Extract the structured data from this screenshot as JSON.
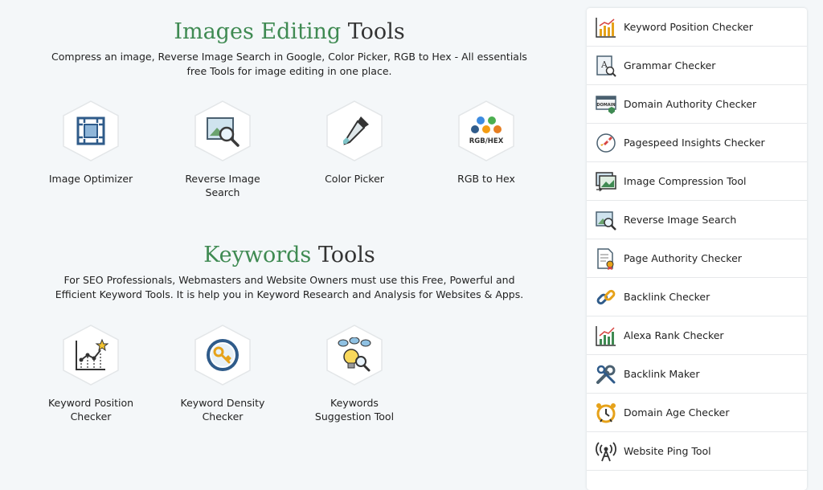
{
  "images_section": {
    "title_accent": "Images Editing",
    "title_rest": "Tools",
    "description": "Compress an image, Reverse Image Search in Google, Color Picker, RGB to Hex - All essentials free Tools for image editing in one place.",
    "tools": [
      {
        "label": "Image Optimizer",
        "icon": "image-optimizer-icon"
      },
      {
        "label": "Reverse Image\nSearch",
        "icon": "reverse-image-search-icon"
      },
      {
        "label": "Color Picker",
        "icon": "color-picker-icon"
      },
      {
        "label": "RGB to Hex",
        "icon": "rgb-hex-icon",
        "icon_text": "RGB/HEX"
      }
    ]
  },
  "keywords_section": {
    "title_accent": "Keywords",
    "title_rest": "Tools",
    "description": "For SEO Professionals, Webmasters and Website Owners must use this Free, Powerful and Efficient Keyword Tools. It is help you in Keyword Research and Analysis for Websites & Apps.",
    "tools": [
      {
        "label": "Keyword Position\nChecker",
        "icon": "keyword-position-icon"
      },
      {
        "label": "Keyword Density\nChecker",
        "icon": "keyword-density-icon"
      },
      {
        "label": "Keywords\nSuggestion Tool",
        "icon": "keywords-suggestion-icon"
      }
    ]
  },
  "sidebar": {
    "items": [
      {
        "label": "Keyword Position Checker",
        "icon": "bar-chart-icon"
      },
      {
        "label": "Grammar Checker",
        "icon": "grammar-document-icon",
        "icon_text": "A"
      },
      {
        "label": "Domain Authority Checker",
        "icon": "domain-authority-icon",
        "icon_text": "DOMAIN"
      },
      {
        "label": "Pagespeed Insights Checker",
        "icon": "rocket-icon"
      },
      {
        "label": "Image Compression Tool",
        "icon": "image-compression-icon"
      },
      {
        "label": "Reverse Image Search",
        "icon": "image-search-icon"
      },
      {
        "label": "Page Authority Checker",
        "icon": "page-authority-icon"
      },
      {
        "label": "Backlink Checker",
        "icon": "chain-link-icon"
      },
      {
        "label": "Alexa Rank Checker",
        "icon": "rank-chart-icon"
      },
      {
        "label": "Backlink Maker",
        "icon": "wrench-icon"
      },
      {
        "label": "Domain Age Checker",
        "icon": "alarm-clock-icon"
      },
      {
        "label": "Website Ping Tool",
        "icon": "ping-antenna-icon"
      }
    ]
  }
}
